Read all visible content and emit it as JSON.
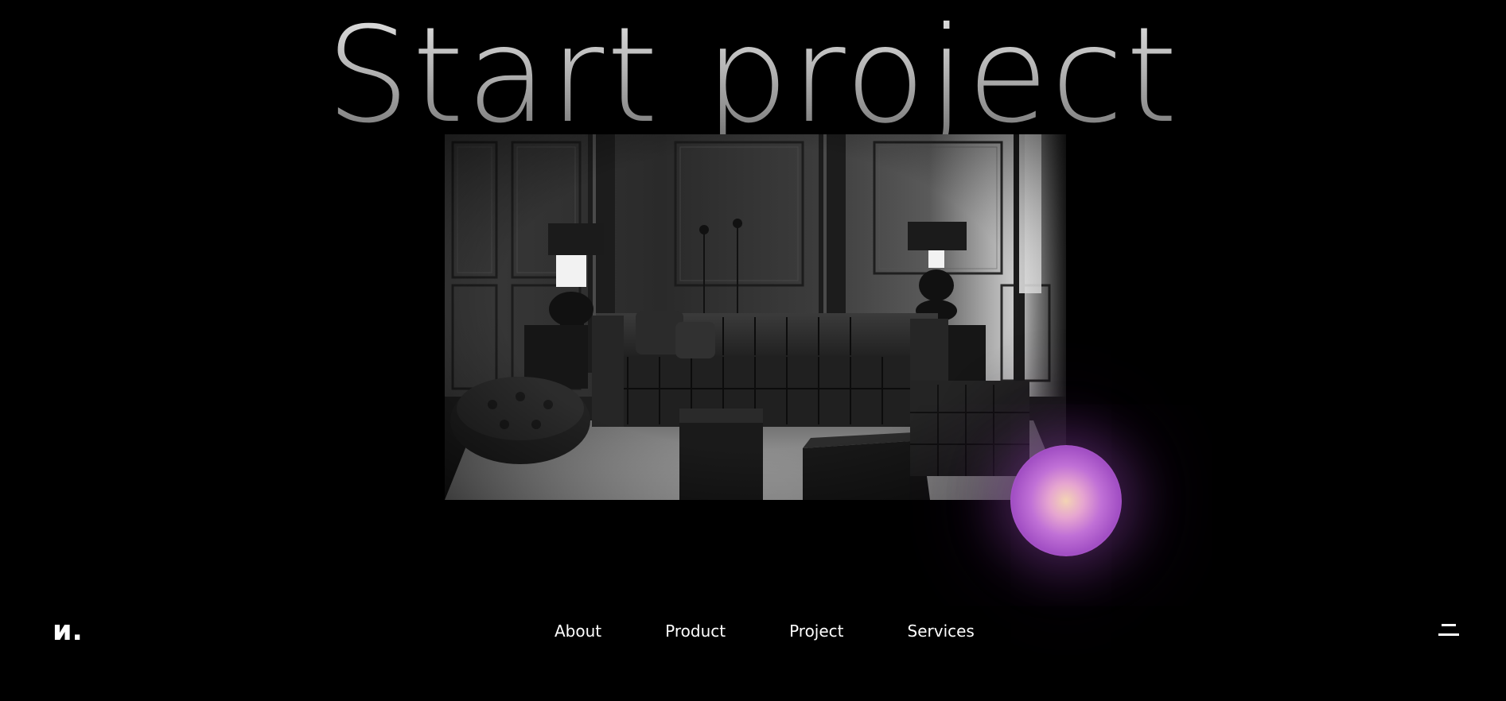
{
  "hero": {
    "title": "Start project"
  },
  "image": {
    "alt": "Dark monochrome living room with tufted sofa, lamps and ottomans"
  },
  "brand": {
    "logo_text": "и."
  },
  "nav": {
    "items": [
      {
        "label": "About"
      },
      {
        "label": "Product"
      },
      {
        "label": "Project"
      },
      {
        "label": "Services"
      }
    ]
  },
  "icons": {
    "menu": "menu-icon",
    "cursor_orb": "glow-orb-icon"
  },
  "colors": {
    "background": "#000000",
    "text": "#ffffff",
    "orb_core": "#f3d3b4",
    "orb_mid": "#c070d6",
    "orb_edge": "#a24fc4"
  }
}
